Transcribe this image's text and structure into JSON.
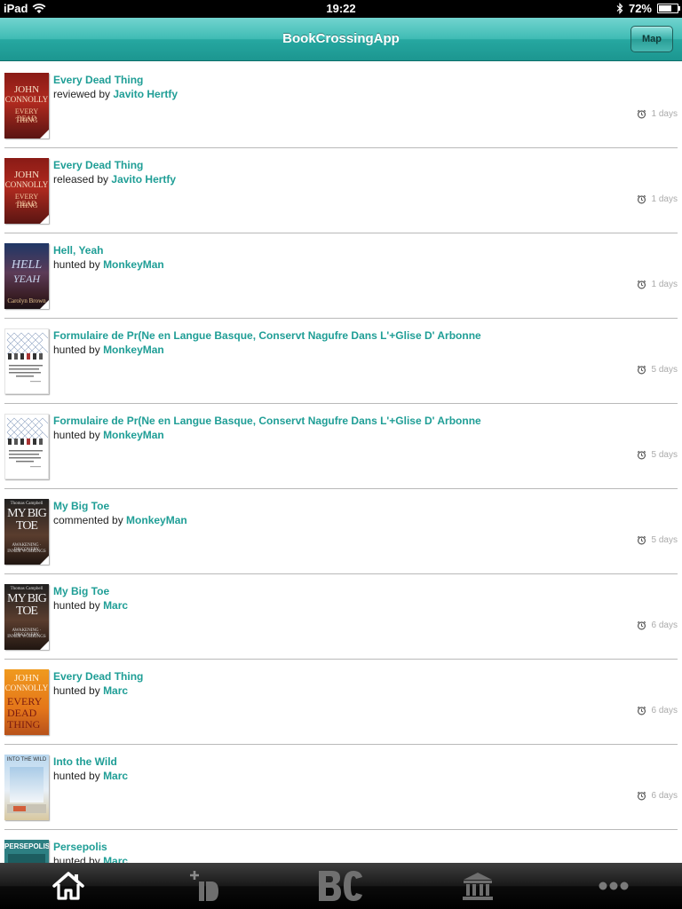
{
  "status_bar": {
    "carrier": "iPad",
    "time": "19:22",
    "battery": "72%",
    "battery_level": 0.72
  },
  "nav": {
    "title": "BookCrossingApp",
    "map_label": "Map"
  },
  "colors": {
    "accent": "#1f9e96",
    "nav_bar": "#3fbbb4",
    "tab_active": "#2ab0a8"
  },
  "feed": [
    {
      "title": "Every Dead Thing",
      "action": "reviewed by",
      "user": "Javito Hertfy",
      "time": "1 days",
      "cover": "connolly-red"
    },
    {
      "title": "Every Dead Thing",
      "action": "released by",
      "user": "Javito Hertfy",
      "time": "1 days",
      "cover": "connolly-red"
    },
    {
      "title": "Hell, Yeah",
      "action": "hunted by",
      "user": "MonkeyMan",
      "time": "1 days",
      "cover": "hell"
    },
    {
      "title": "Formulaire de Pr(Ne en Langue Basque, Conservt Nagufre Dans L'+Glise D' Arbonne",
      "action": "hunted by",
      "user": "MonkeyMan",
      "time": "5 days",
      "cover": "form"
    },
    {
      "title": "Formulaire de Pr(Ne en Langue Basque, Conservt Nagufre Dans L'+Glise D' Arbonne",
      "action": "hunted by",
      "user": "MonkeyMan",
      "time": "5 days",
      "cover": "form"
    },
    {
      "title": "My Big Toe",
      "action": "commented by",
      "user": "MonkeyMan",
      "time": "5 days",
      "cover": "bigtoe"
    },
    {
      "title": "My Big Toe",
      "action": "hunted by",
      "user": "Marc",
      "time": "6 days",
      "cover": "bigtoe"
    },
    {
      "title": "Every Dead Thing",
      "action": "hunted by",
      "user": "Marc",
      "time": "6 days",
      "cover": "connolly-orange"
    },
    {
      "title": "Into the Wild",
      "action": "hunted by",
      "user": "Marc",
      "time": "6 days",
      "cover": "wild"
    },
    {
      "title": "Persepolis",
      "action": "hunted by",
      "user": "Marc",
      "time": "",
      "cover": "persepolis"
    }
  ],
  "tabs": [
    {
      "icon": "home-icon",
      "active": true
    },
    {
      "icon": "add-book-icon",
      "active": false
    },
    {
      "icon": "bookcrossing-logo-icon",
      "active": false
    },
    {
      "icon": "library-icon",
      "active": false
    },
    {
      "icon": "more-icon",
      "active": false
    }
  ]
}
